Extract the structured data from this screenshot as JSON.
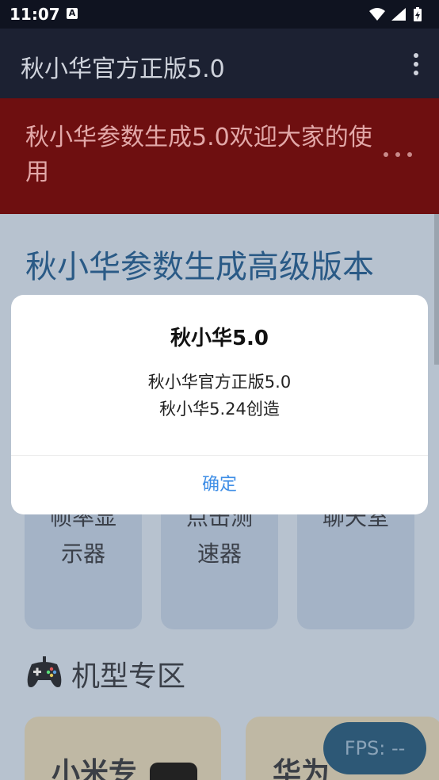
{
  "status": {
    "time": "11:07",
    "notification_letter": "A"
  },
  "app_bar": {
    "title": "秋小华官方正版5.0"
  },
  "banner": {
    "text": "秋小华参数生成5.0欢迎大家的使用"
  },
  "main": {
    "section_title": "秋小华参数生成高级版本",
    "tools": [
      {
        "label_line1": "帧率显",
        "label_line2": "示器"
      },
      {
        "label_line1": "点击测",
        "label_line2": "速器"
      },
      {
        "label_line1": "聊天室",
        "label_line2": ""
      }
    ],
    "device_section_title": "机型专区",
    "device_cards": [
      {
        "label": "小米专"
      },
      {
        "label": "华为"
      }
    ]
  },
  "fps": {
    "label": "FPS: --"
  },
  "dialog": {
    "title": "秋小华5.0",
    "message_line1": "秋小华官方正版5.0",
    "message_line2": "秋小华5.24创造",
    "confirm_label": "确定"
  },
  "colors": {
    "banner": "#6e0f10",
    "accent": "#3f8ee6",
    "app_bar": "#1c2132"
  }
}
